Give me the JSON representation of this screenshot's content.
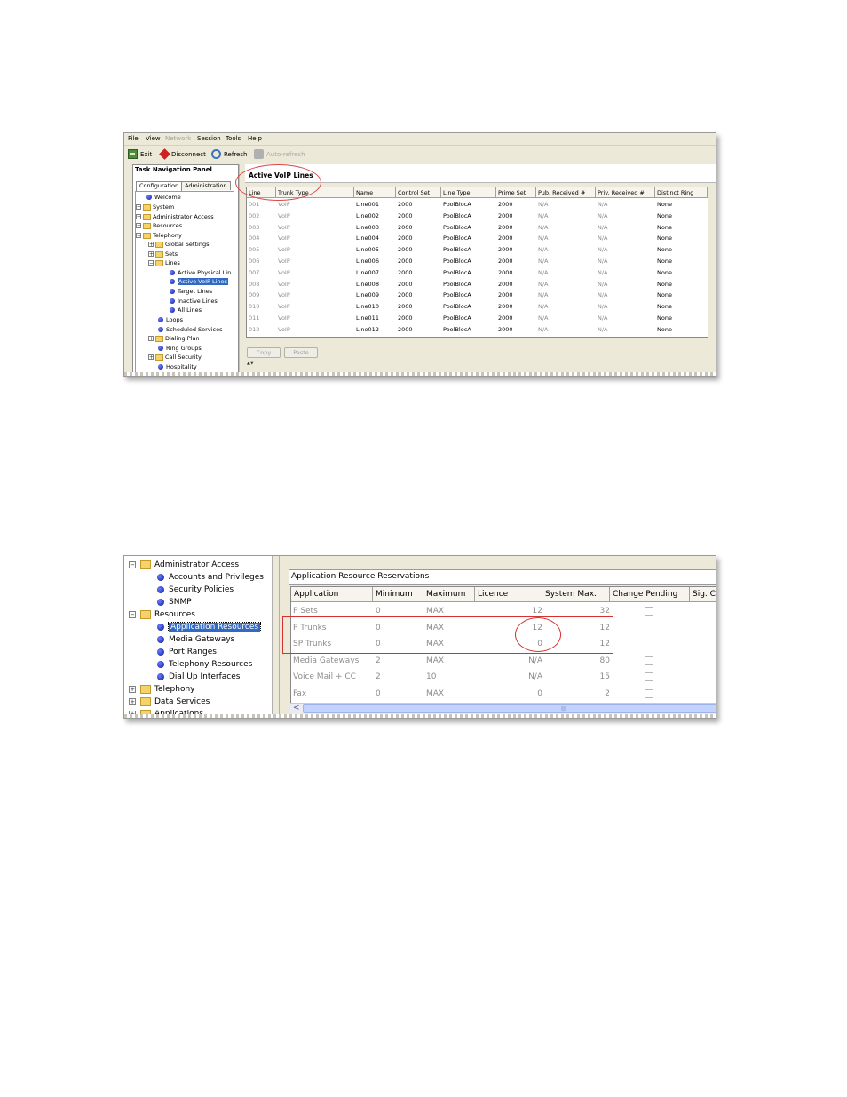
{
  "screen1": {
    "menu": [
      "File",
      "View",
      "Network",
      "Session",
      "Tools",
      "Help"
    ],
    "toolbar": {
      "exit": "Exit",
      "disconnect": "Disconnect",
      "refresh": "Refresh",
      "auto_refresh": "Auto-refresh"
    },
    "nav": {
      "title": "Task Navigation Panel",
      "tabs": [
        "Configuration",
        "Administration"
      ],
      "tree": [
        "Welcome",
        "System",
        "Administrator Access",
        "Resources",
        "Telephony",
        "Global Settings",
        "Sets",
        "Lines",
        "Active Physical Lin",
        "Active VoIP Lines",
        "Target Lines",
        "Inactive Lines",
        "All Lines",
        "Loops",
        "Scheduled Services",
        "Dialing Plan",
        "Ring Groups",
        "Call Security",
        "Hospitality"
      ]
    },
    "main": {
      "title": "Active VoIP Lines",
      "columns": [
        "Line",
        "Trunk Type",
        "Name",
        "Control Set",
        "Line Type",
        "Prime Set",
        "Pub. Received #",
        "Priv. Received #",
        "Distinct Ring"
      ],
      "rows": [
        [
          "001",
          "VoIP",
          "Line001",
          "2000",
          "PoolBlocA",
          "2000",
          "N/A",
          "N/A",
          "None"
        ],
        [
          "002",
          "VoIP",
          "Line002",
          "2000",
          "PoolBlocA",
          "2000",
          "N/A",
          "N/A",
          "None"
        ],
        [
          "003",
          "VoIP",
          "Line003",
          "2000",
          "PoolBlocA",
          "2000",
          "N/A",
          "N/A",
          "None"
        ],
        [
          "004",
          "VoIP",
          "Line004",
          "2000",
          "PoolBlocA",
          "2000",
          "N/A",
          "N/A",
          "None"
        ],
        [
          "005",
          "VoIP",
          "Line005",
          "2000",
          "PoolBlocA",
          "2000",
          "N/A",
          "N/A",
          "None"
        ],
        [
          "006",
          "VoIP",
          "Line006",
          "2000",
          "PoolBlocA",
          "2000",
          "N/A",
          "N/A",
          "None"
        ],
        [
          "007",
          "VoIP",
          "Line007",
          "2000",
          "PoolBlocA",
          "2000",
          "N/A",
          "N/A",
          "None"
        ],
        [
          "008",
          "VoIP",
          "Line008",
          "2000",
          "PoolBlocA",
          "2000",
          "N/A",
          "N/A",
          "None"
        ],
        [
          "009",
          "VoIP",
          "Line009",
          "2000",
          "PoolBlocA",
          "2000",
          "N/A",
          "N/A",
          "None"
        ],
        [
          "010",
          "VoIP",
          "Line010",
          "2000",
          "PoolBlocA",
          "2000",
          "N/A",
          "N/A",
          "None"
        ],
        [
          "011",
          "VoIP",
          "Line011",
          "2000",
          "PoolBlocA",
          "2000",
          "N/A",
          "N/A",
          "None"
        ],
        [
          "012",
          "VoIP",
          "Line012",
          "2000",
          "PoolBlocA",
          "2000",
          "N/A",
          "N/A",
          "None"
        ]
      ],
      "buttons": {
        "copy": "Copy",
        "paste": "Paste"
      }
    }
  },
  "screen2": {
    "tree": [
      {
        "label": "Administrator Access",
        "selected": false
      },
      {
        "label": "Accounts and Privileges",
        "selected": false
      },
      {
        "label": "Security Policies",
        "selected": false
      },
      {
        "label": "SNMP",
        "selected": false
      },
      {
        "label": "Resources",
        "selected": false
      },
      {
        "label": "Application Resources",
        "selected": true
      },
      {
        "label": "Media Gateways",
        "selected": false
      },
      {
        "label": "Port Ranges",
        "selected": false
      },
      {
        "label": "Telephony Resources",
        "selected": false
      },
      {
        "label": "Dial Up Interfaces",
        "selected": false
      },
      {
        "label": "Telephony",
        "selected": false
      },
      {
        "label": "Data Services",
        "selected": false
      },
      {
        "label": "Applications",
        "selected": false
      }
    ],
    "main": {
      "title": "Application Resource Reservations",
      "columns": [
        "Application",
        "Minimum",
        "Maximum",
        "Licence",
        "System Max.",
        "Change Pending",
        "Sig. C"
      ],
      "rows": [
        [
          "P Sets",
          "0",
          "MAX",
          "12",
          "32"
        ],
        [
          "P Trunks",
          "0",
          "MAX",
          "12",
          "12"
        ],
        [
          "SP Trunks",
          "0",
          "MAX",
          "0",
          "12"
        ],
        [
          "Media Gateways",
          "2",
          "MAX",
          "N/A",
          "80"
        ],
        [
          "Voice Mail + CC",
          "2",
          "10",
          "N/A",
          "15"
        ],
        [
          "Fax",
          "0",
          "MAX",
          "0",
          "2"
        ]
      ],
      "scroll_grip": "|||"
    }
  },
  "colors": {
    "highlight": "#d63030",
    "selection": "#316ac5",
    "window_bg": "#ece9d8"
  },
  "icons": {
    "exit": "exit-icon",
    "disconnect": "disconnect-icon",
    "refresh": "refresh-icon",
    "auto_refresh": "auto-refresh-icon",
    "folder": "folder-icon",
    "leaf": "bullet-icon",
    "expand": "expand-icon",
    "collapse": "collapse-icon"
  }
}
